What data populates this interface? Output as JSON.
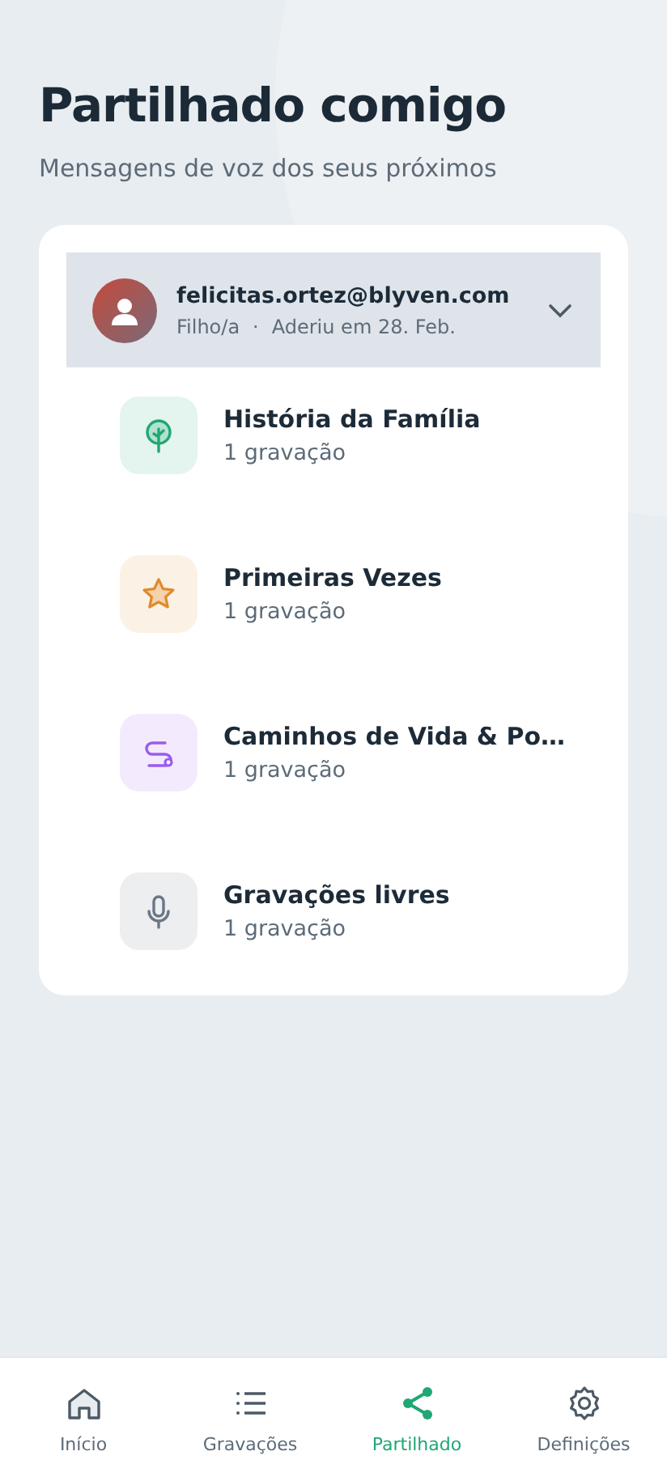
{
  "header": {
    "title": "Partilhado comigo",
    "subtitle": "Mensagens de voz dos seus próximos"
  },
  "contact": {
    "email": "felicitas.ortez@blyven.com",
    "relation": "Filho/a",
    "separator": "·",
    "joined": "Aderiu em 28. Feb.",
    "expanded": true
  },
  "categories": [
    {
      "kind": "tree",
      "color": "#1fa774",
      "title": "História da Família",
      "count": "1 gravação"
    },
    {
      "kind": "star",
      "color": "#e08a2c",
      "title": "Primeiras Vezes",
      "count": "1 gravação"
    },
    {
      "kind": "path",
      "color": "#9a5cf0",
      "title": "Caminhos de Vida & Po…",
      "count": "1 gravação"
    },
    {
      "kind": "mic",
      "color": "#6b7785",
      "title": "Gravações livres",
      "count": "1 gravação"
    }
  ],
  "bottom_nav": [
    {
      "kind": "home",
      "label": "Início",
      "selected": false
    },
    {
      "kind": "list",
      "label": "Gravações",
      "selected": false
    },
    {
      "kind": "share",
      "label": "Partilhado",
      "selected": true
    },
    {
      "kind": "gear",
      "label": "Definições",
      "selected": false
    }
  ]
}
